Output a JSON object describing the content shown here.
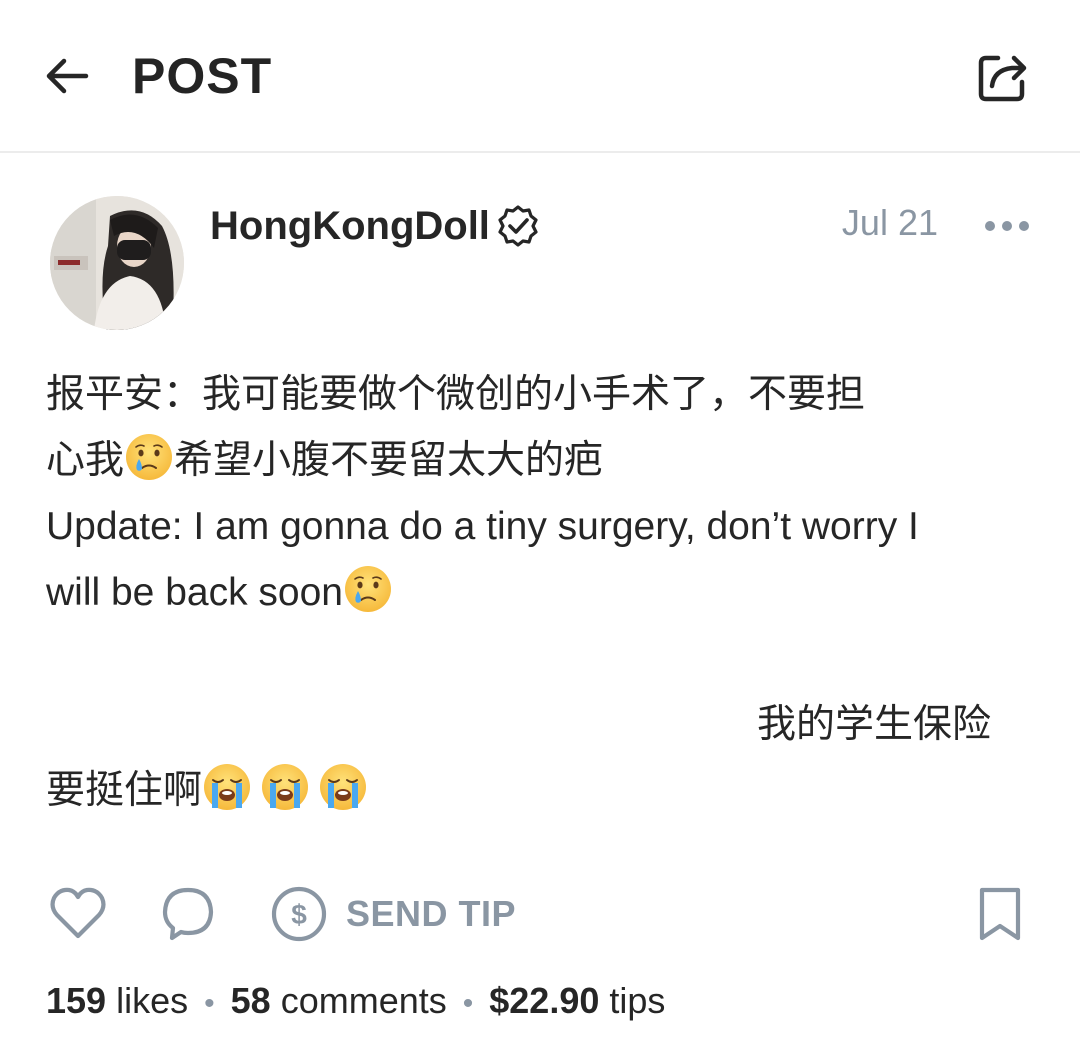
{
  "header": {
    "title": "POST",
    "back_icon": "arrow-left-icon",
    "share_icon": "share-icon"
  },
  "post": {
    "author": "HongKongDoll",
    "verified": true,
    "date": "Jul 21",
    "more_icon": "more-horizontal-icon",
    "lines": {
      "l1": "报平安：我可能要做个微创的小手术了，不要担",
      "l2a": "心我",
      "l2b": "希望小腹不要留太大的疤",
      "l3": "Update: I am gonna do a tiny surgery, don’t worry I",
      "l4": "will be back soon",
      "l6": "我的学生保险",
      "l7": "要挺住啊"
    },
    "emoji": {
      "crying": "crying-face-emoji",
      "loudly_crying": "loudly-crying-face-emoji"
    }
  },
  "actions": {
    "like_icon": "heart-icon",
    "comment_icon": "comment-icon",
    "tip_icon": "dollar-coin-icon",
    "tip_label": "SEND TIP",
    "bookmark_icon": "bookmark-icon"
  },
  "stats": {
    "likes_count": "159",
    "likes_label": "likes",
    "comments_count": "58",
    "comments_label": "comments",
    "tips_amount": "$22.90",
    "tips_label": "tips",
    "separator": "•"
  },
  "colors": {
    "text": "#262626",
    "muted": "#8a96a3",
    "divider": "#ececec",
    "background": "#ffffff"
  }
}
